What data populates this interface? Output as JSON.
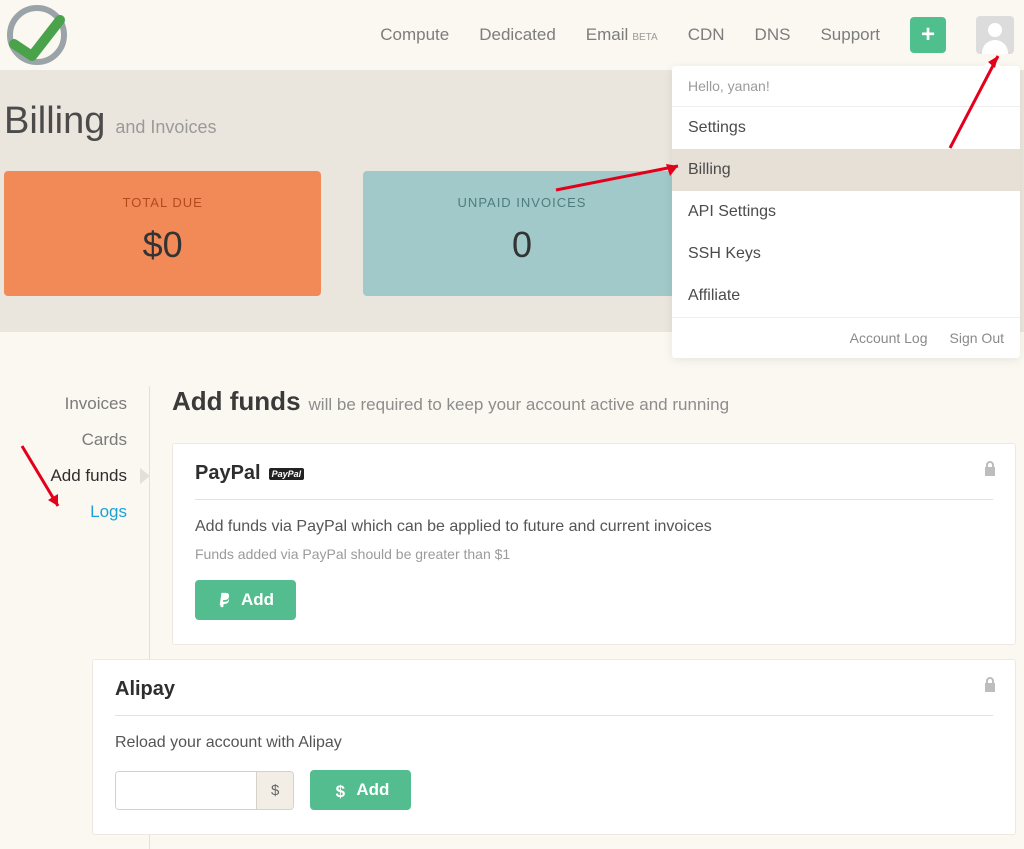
{
  "nav": {
    "items": [
      "Compute",
      "Dedicated",
      "Email",
      "CDN",
      "DNS",
      "Support"
    ],
    "beta": "BETA"
  },
  "dropdown": {
    "hello": "Hello, yanan!",
    "items": [
      "Settings",
      "Billing",
      "API Settings",
      "SSH Keys",
      "Affiliate"
    ],
    "footer": [
      "Account Log",
      "Sign Out"
    ]
  },
  "billing": {
    "title": "Billing",
    "subtitle": "and Invoices",
    "cards": [
      {
        "label": "TOTAL DUE",
        "value": "$0"
      },
      {
        "label": "UNPAID INVOICES",
        "value": "0"
      }
    ]
  },
  "sidebar": {
    "items": [
      "Invoices",
      "Cards",
      "Add funds",
      "Logs"
    ]
  },
  "main": {
    "heading": "Add funds",
    "heading_rest": "will be required to keep your account active and running",
    "paypal": {
      "title": "PayPal",
      "badge": "PayPal",
      "desc": "Add funds via PayPal which can be applied to future and current invoices",
      "note": "Funds added via PayPal should be greater than $1",
      "btn": "Add"
    },
    "alipay": {
      "title": "Alipay",
      "desc": "Reload your account with Alipay",
      "currency": "$",
      "btn": "Add"
    }
  }
}
